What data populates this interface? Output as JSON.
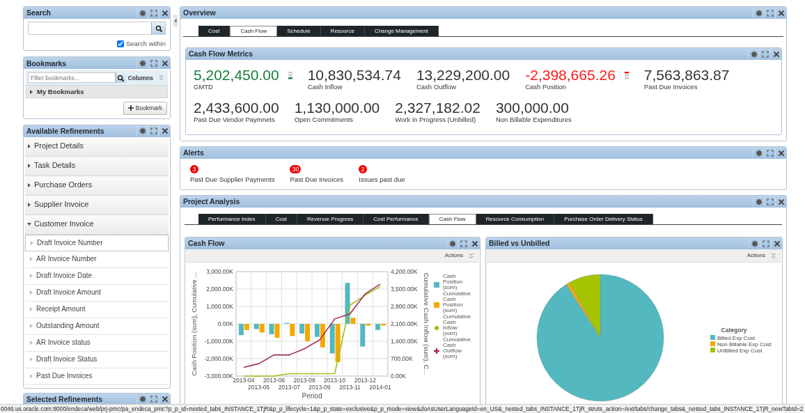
{
  "search_panel": {
    "title": "Search",
    "search_within": {
      "label": "Search within",
      "checked": true
    }
  },
  "bookmarks_panel": {
    "title": "Bookmarks",
    "filter_placeholder": "Filter bookmarks...",
    "columns_label": "Columns",
    "folder": "My Bookmarks",
    "add_button": "Bookmark"
  },
  "refinements_panel": {
    "title": "Available Refinements",
    "groups": [
      {
        "label": "Project Details",
        "expanded": false
      },
      {
        "label": "Task Details",
        "expanded": false
      },
      {
        "label": "Purchase Orders",
        "expanded": false
      },
      {
        "label": "Supplier Invoice",
        "expanded": false
      },
      {
        "label": "Customer Invoice",
        "expanded": true,
        "children": [
          {
            "label": "Draft Invoice Number",
            "selected": true
          },
          {
            "label": "AR Invoice Number",
            "selected": false
          },
          {
            "label": "Draft Invoice Date",
            "selected": false
          },
          {
            "label": "Draft Invoice Amount",
            "selected": false
          },
          {
            "label": "Receipt Amount",
            "selected": false
          },
          {
            "label": "Outstanding Amount",
            "selected": false
          },
          {
            "label": "AR Invoice status",
            "selected": false
          },
          {
            "label": "Draft Invoice Status",
            "selected": false
          },
          {
            "label": "Past Due Invoices",
            "selected": false
          }
        ]
      }
    ]
  },
  "selected_refinements_panel": {
    "title": "Selected Refinements"
  },
  "overview": {
    "title": "Overview",
    "tabs": [
      {
        "label": "Cost",
        "selected": false
      },
      {
        "label": "Cash Flow",
        "selected": true
      },
      {
        "label": "Schedule",
        "selected": false
      },
      {
        "label": "Resource",
        "selected": false
      },
      {
        "label": "Change Management",
        "selected": false
      }
    ],
    "metrics_panel": {
      "title": "Cash Flow Metrics",
      "rows": [
        {
          "metrics": [
            {
              "value": "5,202,450.00",
              "label": "GMTD",
              "color": "#1a7d3c",
              "kind": "low"
            },
            {
              "value": "10,830,534.74",
              "label": "Cash Inflow",
              "color": "#333333"
            },
            {
              "value": "13,229,200.00",
              "label": "Cash Outflow",
              "color": "#333333"
            },
            {
              "value": "-2,398,665.26",
              "label": "Cash Position",
              "color": "#ff1a1a",
              "kind": "high"
            },
            {
              "value": "7,563,863.87",
              "label": "Past Due Invoices",
              "color": "#333333"
            }
          ]
        },
        {
          "metrics": [
            {
              "value": "2,433,600.00",
              "label": "Past Due Vendor Paymnets",
              "color": "#333333"
            },
            {
              "value": "1,130,000.00",
              "label": "Open Commitments",
              "color": "#333333"
            },
            {
              "value": "2,327,182.02",
              "label": "Work in Progress (Unbilled)",
              "color": "#333333"
            },
            {
              "value": "300,000.00",
              "label": "Non Billable Expenditures",
              "color": "#333333"
            }
          ]
        }
      ]
    }
  },
  "alerts": {
    "title": "Alerts",
    "items": [
      {
        "count": "3",
        "label": "Past Due Supplier Payments"
      },
      {
        "count": "30",
        "label": "Past Due Invoices"
      },
      {
        "count": "2",
        "label": "Issues past due"
      }
    ]
  },
  "project_analysis": {
    "title": "Project Analysis",
    "tabs": [
      {
        "label": "Performance Index",
        "selected": false
      },
      {
        "label": "Cost",
        "selected": false
      },
      {
        "label": "Revenue Progress",
        "selected": false
      },
      {
        "label": "Cost Performance",
        "selected": false
      },
      {
        "label": "Cash Flow",
        "selected": true
      },
      {
        "label": "Resource Consumption",
        "selected": false
      },
      {
        "label": "Purchase Order Delivery Status",
        "selected": false
      }
    ],
    "cash_flow_panel": {
      "title": "Cash Flow",
      "actions": "Actions",
      "chart_data": {
        "type": "bar",
        "legend": "right",
        "grid": true,
        "xlabel": "Period",
        "ylabel": "Cash Position (sum), Cumulative ...",
        "y2label": "Cumulative Cash Inflow (sum), C...",
        "categories": [
          "2013-04",
          "2013-05",
          "2013-06",
          "2013-07",
          "2013-08",
          "2013-09",
          "2013-10",
          "2013-11",
          "2013-12",
          "2014-01"
        ],
        "ylim": [
          -3000,
          3000
        ],
        "yticks": [
          {
            "value": -3000,
            "label": "-3,000.00K"
          },
          {
            "value": -2000,
            "label": "-2,000.00K"
          },
          {
            "value": -1000,
            "label": "-1,000.00K"
          },
          {
            "value": 0,
            "label": "0.00K"
          },
          {
            "value": 1000,
            "label": "1,000.00K"
          },
          {
            "value": 2000,
            "label": "2,000.00K"
          },
          {
            "value": 3000,
            "label": "3,000.00K"
          }
        ],
        "y2lim": [
          0,
          4200
        ],
        "y2ticks": [
          {
            "value": 0,
            "label": "0.00K"
          },
          {
            "value": 700,
            "label": "700.00K"
          },
          {
            "value": 1400,
            "label": "1,400.00K"
          },
          {
            "value": 2100,
            "label": "2,100.00K"
          },
          {
            "value": 2800,
            "label": "2,800.00K"
          },
          {
            "value": 3500,
            "label": "3,500.00K"
          },
          {
            "value": 4200,
            "label": "4,200.00K"
          }
        ],
        "series": [
          {
            "name": "Cash Position (sum)",
            "color": "#53b8bf",
            "type": "bar",
            "values": [
              -650,
              -300,
              -600,
              50,
              -550,
              -750,
              -1700,
              2350,
              -1300,
              -350
            ]
          },
          {
            "name": "Cumulative Cash Position (sum)",
            "color": "#f5a800",
            "type": "bar",
            "values": [
              -350,
              -500,
              -800,
              -700,
              -1000,
              -1350,
              -2200,
              350,
              -100,
              -100
            ]
          },
          {
            "name": "Cumulative Cash Inflow (sum)",
            "color": "#9bc31c",
            "type": "line",
            "axis": "y2",
            "values": [
              0,
              0,
              0,
              100,
              100,
              100,
              100,
              2850,
              3250,
              3600
            ]
          },
          {
            "name": "Cumulative Cash Outflow (sum)",
            "color": "#a0305a",
            "type": "line",
            "axis": "y2",
            "values": [
              350,
              500,
              850,
              850,
              1100,
              1450,
              2300,
              2500,
              3300,
              3700
            ]
          }
        ]
      }
    },
    "billed_panel": {
      "title": "Billed vs Unbilled",
      "actions": "Actions",
      "chart_data": {
        "type": "pie",
        "legend": "right",
        "legend_title": "Category",
        "categories": [
          "Billed Exp Cost",
          "Non Billable Exp Cost",
          "UnBilled Exp Cost"
        ],
        "series": [
          {
            "values": [
              91,
              1,
              8
            ],
            "colors": [
              "#53b8bf",
              "#f5a800",
              "#a5c400"
            ]
          }
        ]
      }
    }
  },
  "status_bar": "0046.us.oracle.com:8000/endeca/web/prj-pmc/pa_endeca_pmc?p_p_id=nested_tabs_INSTANCE_1TjR&p_p_lifecycle=1&p_p_state=exclusive&p_p_mode=view&doAsUserLanguageId=en_US&_nested_tabs_INSTANCE_1TjR_struts_action=/ext/tabs/change_tabs&_nested_tabs_INSTANCE_1TjR_newTabId=2"
}
